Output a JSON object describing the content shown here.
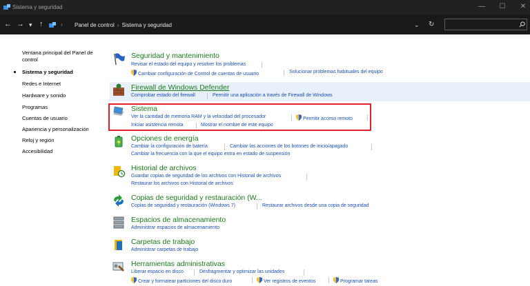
{
  "window": {
    "title": "Sistema y seguridad",
    "minimize": "—",
    "maximize": "☐",
    "close": "✕"
  },
  "address": {
    "back": "←",
    "forward": "→",
    "recent": "▾",
    "up": "↑",
    "breadcrumb": [
      "Panel de control",
      "Sistema y seguridad"
    ],
    "dropdown": "⌄",
    "refresh": "↻",
    "search_placeholder": ""
  },
  "sidebar": {
    "items": [
      {
        "label": "Ventana principal del Panel de control"
      },
      {
        "label": "Sistema y seguridad",
        "current": true
      },
      {
        "label": "Redes e Internet"
      },
      {
        "label": "Hardware y sonido"
      },
      {
        "label": "Programas"
      },
      {
        "label": "Cuentas de usuario"
      },
      {
        "label": "Apariencia y personalización"
      },
      {
        "label": "Reloj y región"
      },
      {
        "label": "Accesibilidad"
      }
    ]
  },
  "categories": {
    "security": {
      "title": "Seguridad y mantenimiento",
      "links": [
        "Revisar el estado del equipo y resolver los problemas",
        "Cambiar configuración de Control de cuentas de usuario",
        "Solucionar problemas habituales del equipo"
      ]
    },
    "firewall": {
      "title": "Firewall de Windows Defender",
      "links": [
        "Comprobar estado del firewall",
        "Permitir una aplicación a través de Firewall de Windows"
      ]
    },
    "system": {
      "title": "Sistema",
      "links": [
        "Ver la cantidad de memoria RAM y la velocidad del procesador",
        "Permitir acceso remoto",
        "Iniciar asistencia remota",
        "Mostrar el nombre de este equipo"
      ]
    },
    "power": {
      "title": "Opciones de energía",
      "links": [
        "Cambiar la configuración de batería",
        "Cambiar las acciones de los botones de inicio/apagado",
        "Cambiar la frecuencia con la que el equipo entra en estado de suspensión"
      ]
    },
    "history": {
      "title": "Historial de archivos",
      "links": [
        "Guardar copias de seguridad de los archivos con Historial de archivos",
        "Restaurar los archivos con Historial de archivos"
      ]
    },
    "backup": {
      "title": "Copias de seguridad y restauración (W...",
      "links": [
        "Copias de seguridad y restauración (Windows 7)",
        "Restaurar archivos desde una copia de seguridad"
      ]
    },
    "storage": {
      "title": "Espacios de almacenamiento",
      "links": [
        "Administrar espacios de almacenamiento"
      ]
    },
    "work": {
      "title": "Carpetas de trabajo",
      "links": [
        "Administrar carpetas de trabajo"
      ]
    },
    "admin": {
      "title": "Herramientas administrativas",
      "links": [
        "Liberar espacio en disco",
        "Desfragmentar y optimizar las unidades",
        "Crear y formatear particiones del disco duro",
        "Ver registros de eventos",
        "Programar tareas"
      ]
    }
  },
  "colors": {
    "title_green": "#1a7a1a",
    "link_blue": "#1a4fb5",
    "highlight_red": "#e0202a",
    "titlebar_dark": "#202020"
  }
}
